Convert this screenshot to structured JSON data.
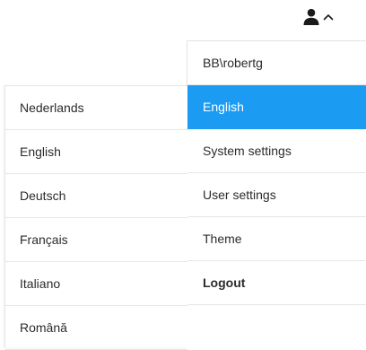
{
  "header": {
    "user_icon": "user-icon",
    "chevron_icon": "chevron-up-icon"
  },
  "main_menu": {
    "items": [
      {
        "label": "BB\\robertg"
      },
      {
        "label": "English"
      },
      {
        "label": "System settings"
      },
      {
        "label": "User settings"
      },
      {
        "label": "Theme"
      },
      {
        "label": "Logout"
      }
    ]
  },
  "language_menu": {
    "items": [
      {
        "label": "Nederlands"
      },
      {
        "label": "English"
      },
      {
        "label": "Deutsch"
      },
      {
        "label": "Français"
      },
      {
        "label": "Italiano"
      },
      {
        "label": "Română"
      }
    ]
  },
  "colors": {
    "accent": "#1b9cf2",
    "text": "#2b2b2b",
    "border": "#e6e6e6",
    "background": "#ffffff"
  }
}
